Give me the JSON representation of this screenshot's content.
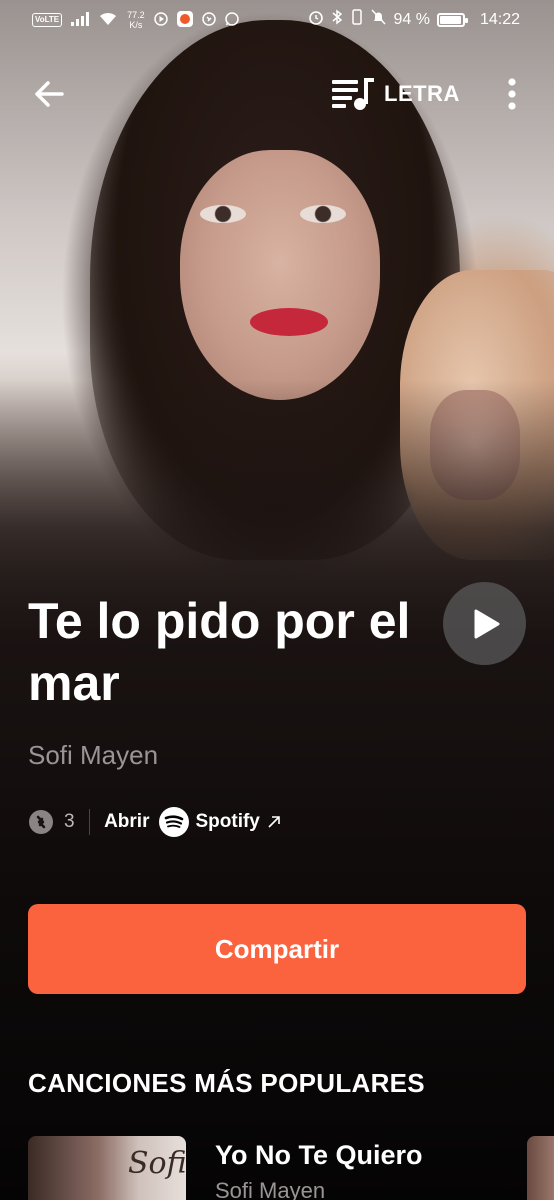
{
  "status_bar": {
    "volte": "VoLTE",
    "signal": "4G",
    "net_speed_value": "77.2",
    "net_speed_unit": "K/s",
    "battery_percent": "94 %",
    "battery_level": 0.94,
    "time": "14:22"
  },
  "header": {
    "lyrics_label": "LETRA"
  },
  "song": {
    "title": "Te lo pido por el mar",
    "artist": "Sofi Mayen",
    "shazam_count": "3",
    "open_label": "Abrir",
    "spotify_label": "Spotify"
  },
  "actions": {
    "share_label": "Compartir"
  },
  "popular": {
    "section_title": "CANCIONES MÁS POPULARES",
    "items": [
      {
        "title": "Yo No Te Quiero",
        "artist": "Sofi Mayen",
        "cover_text": "Sofi"
      }
    ]
  },
  "colors": {
    "accent": "#fb633f",
    "muted_text": "#9a9494"
  }
}
